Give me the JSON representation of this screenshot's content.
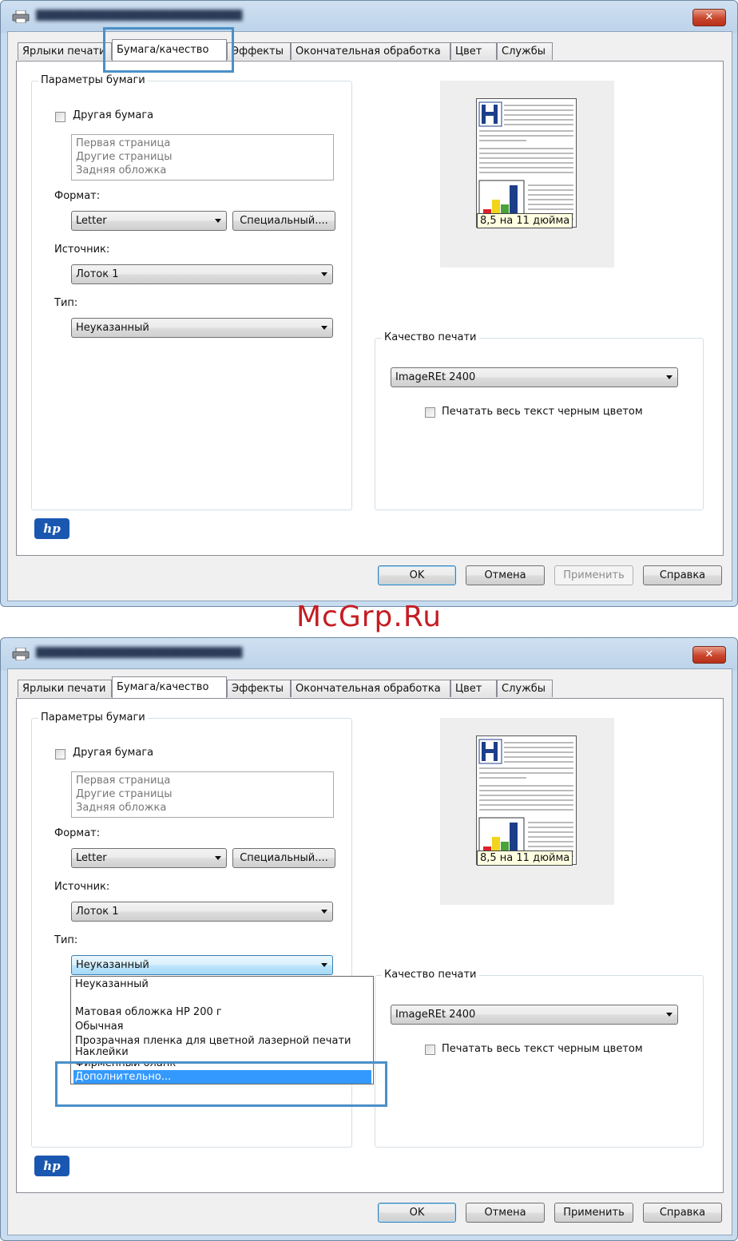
{
  "watermark": "McGrp.Ru",
  "close_symbol": "✕",
  "tabs": [
    "Ярлыки печати",
    "Бумага/качество",
    "Эффекты",
    "Окончательная обработка",
    "Цвет",
    "Службы"
  ],
  "paper_options": {
    "legend": "Параметры бумаги",
    "other_paper_label": "Другая бумага",
    "pages_list": [
      "Первая страница",
      "Другие страницы",
      "Задняя обложка"
    ],
    "format_label": "Формат:",
    "format_value": "Letter",
    "custom_button": "Специальный....",
    "source_label": "Источник:",
    "source_value": "Лоток 1",
    "type_label": "Тип:",
    "type_value": "Неуказанный"
  },
  "preview": {
    "size_label": "8,5 на 11 дюйма"
  },
  "print_quality": {
    "legend": "Качество печати",
    "value": "ImageREt 2400",
    "black_text_label": "Печатать весь текст черным цветом"
  },
  "logo": "hp",
  "buttons": {
    "ok": "OK",
    "cancel": "Отмена",
    "apply": "Применить",
    "help": "Справка"
  },
  "type_dropdown": {
    "items": [
      "Неуказанный",
      "",
      "Матовая обложка HP 200 г",
      "Обычная",
      "Прозрачная пленка для цветной лазерной печати",
      "Наклейки",
      "Фирменный бланк",
      "Дополнительно..."
    ],
    "selected_index": 7
  },
  "colors": {
    "highlight": "#4a90c8",
    "watermark": "#c41d23",
    "selection": "#3399ff",
    "hp_blue": "#1a57b0"
  }
}
